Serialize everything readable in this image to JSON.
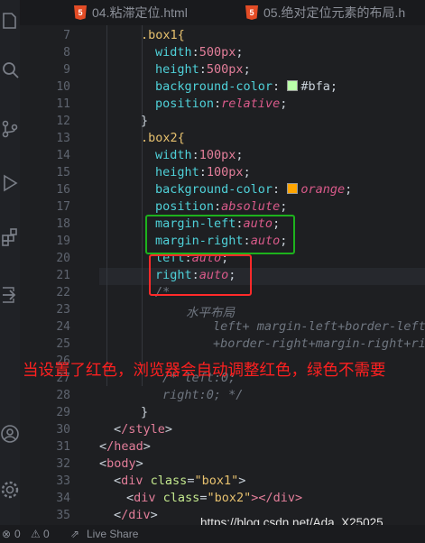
{
  "tabs": [
    {
      "name": "04.粘滞定位.html"
    },
    {
      "name": "05.绝对定位元素的布局.h"
    }
  ],
  "line_numbers": [
    "7",
    "8",
    "9",
    "10",
    "11",
    "12",
    "13",
    "14",
    "15",
    "16",
    "17",
    "18",
    "19",
    "20",
    "21",
    "22",
    "23",
    "24",
    "25",
    "26",
    "27",
    "28",
    "29",
    "30",
    "31",
    "32",
    "33",
    "34",
    "35"
  ],
  "code": {
    "l7": ".box1{",
    "l8_p": "width",
    "l8_v": "500px",
    "l9_p": "height",
    "l9_v": "500px",
    "l10_p": "background-color",
    "l10_v": "#bfa",
    "l11_p": "position",
    "l11_v": "relative",
    "l12": "}",
    "l13": ".box2{",
    "l14_p": "width",
    "l14_v": "100px",
    "l15_p": "height",
    "l15_v": "100px",
    "l16_p": "background-color",
    "l16_v": "orange",
    "l17_p": "position",
    "l17_v": "absolute",
    "l18_p": "margin-left",
    "l18_v": "auto",
    "l19_p": "margin-right",
    "l19_v": "auto",
    "l20_p": "left",
    "l20_v": "auto",
    "l21_p": "right",
    "l21_v": "auto",
    "l22": "/*",
    "l23": "水平布局",
    "l24": "left+ margin-left+border-left+",
    "l25": "+border-right+margin-right+rig",
    "l27": "/* left:0;",
    "l28": "right:0; */",
    "l29": "}",
    "l30_tag": "/style",
    "l31_tag": "/head",
    "l32_tag": "body",
    "l33_tag": "div",
    "l33_attr": "class",
    "l33_str": "\"box1\"",
    "l34_tag": "div",
    "l34_attr": "class",
    "l34_str": "\"box2\"",
    "l34_close": "></div>",
    "l35_tag": "/div"
  },
  "colors": {
    "swatch_bfa": "#bbffaa",
    "swatch_orange": "#ffa500"
  },
  "annotation": "当设置了红色，浏览器会自动调整红色，绿色不需要",
  "watermark": "https://blog.csdn.net/Ada_X25025",
  "status": {
    "errors": "0",
    "warnings": "0",
    "live_share": "Live Share"
  },
  "icons": [
    "explorer-icon",
    "search-icon",
    "source-control-icon",
    "run-icon",
    "extensions-icon",
    "remote-icon",
    "account-icon",
    "settings-icon"
  ]
}
